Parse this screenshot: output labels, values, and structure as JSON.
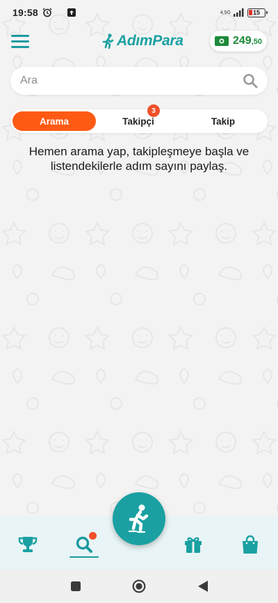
{
  "status_bar": {
    "time": "19:58",
    "network": "4,5G",
    "battery": "15"
  },
  "header": {
    "app_name": "AdımPara",
    "wallet": {
      "amount_main": "249",
      "amount_decimal": ",50"
    }
  },
  "search": {
    "placeholder": "Ara"
  },
  "tabs": [
    {
      "label": "Arama",
      "active": true
    },
    {
      "label": "Takipçi",
      "badge": "3"
    },
    {
      "label": "Takip"
    }
  ],
  "empty_message": "Hemen arama yap, takipleşmeye başla ve listendekilerle adım sayını paylaş.",
  "bottom_nav": {
    "items": [
      "trophy-icon",
      "search-icon",
      "walk-icon",
      "gift-icon",
      "shopping-bag-icon"
    ],
    "active": "search-icon"
  },
  "colors": {
    "teal": "#1aa0a2",
    "orange": "#ff5a14",
    "badge_red": "#f1502b",
    "money_green": "#1d8a3a"
  }
}
